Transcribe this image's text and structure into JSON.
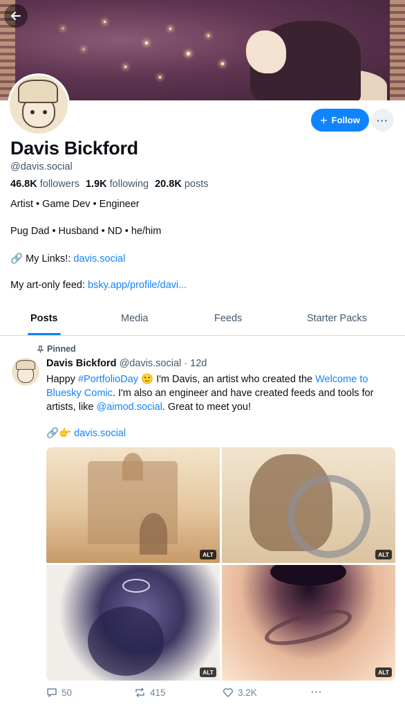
{
  "profile": {
    "name": "Davis Bickford",
    "handle": "@davis.social",
    "followers_count": "46.8K",
    "followers_label": "followers",
    "following_count": "1.9K",
    "following_label": "following",
    "posts_count": "20.8K",
    "posts_label": "posts",
    "bio_line1": "Artist • Game Dev • Engineer",
    "bio_line2": "Pug Dad • Husband • ND • he/him",
    "links_prefix": "🔗 My Links!: ",
    "links_url": "davis.social",
    "art_feed_prefix": "My art-only feed: ",
    "art_feed_url": "bsky.app/profile/davi..."
  },
  "actions": {
    "follow_label": "Follow",
    "more_label": "···"
  },
  "tabs": [
    {
      "label": "Posts",
      "active": true
    },
    {
      "label": "Media",
      "active": false
    },
    {
      "label": "Feeds",
      "active": false
    },
    {
      "label": "Starter Packs",
      "active": false
    }
  ],
  "post": {
    "pinned_label": "Pinned",
    "author_name": "Davis Bickford",
    "author_handle": "@davis.social",
    "time": "· 12d",
    "text_part1": "Happy ",
    "hashtag": "#PortfolioDay",
    "text_part2": " 🙂 I'm Davis, an artist who created the ",
    "comic_link": "Welcome to Bluesky Comic",
    "text_part3": ". I'm also an engineer and have created feeds and tools for artists, like ",
    "mention": "@aimod.social",
    "text_part4": ". Great to meet you!",
    "link_emoji": "🔗👉",
    "link_text": "davis.social",
    "images": [
      {
        "alt_badge": "ALT"
      },
      {
        "alt_badge": "ALT"
      },
      {
        "alt_badge": "ALT"
      },
      {
        "alt_badge": "ALT"
      }
    ],
    "reply_count": "50",
    "repost_count": "415",
    "like_count": "3.2K",
    "more_label": "···"
  },
  "colors": {
    "accent": "#1083fe",
    "secondary_text": "#42576c"
  }
}
